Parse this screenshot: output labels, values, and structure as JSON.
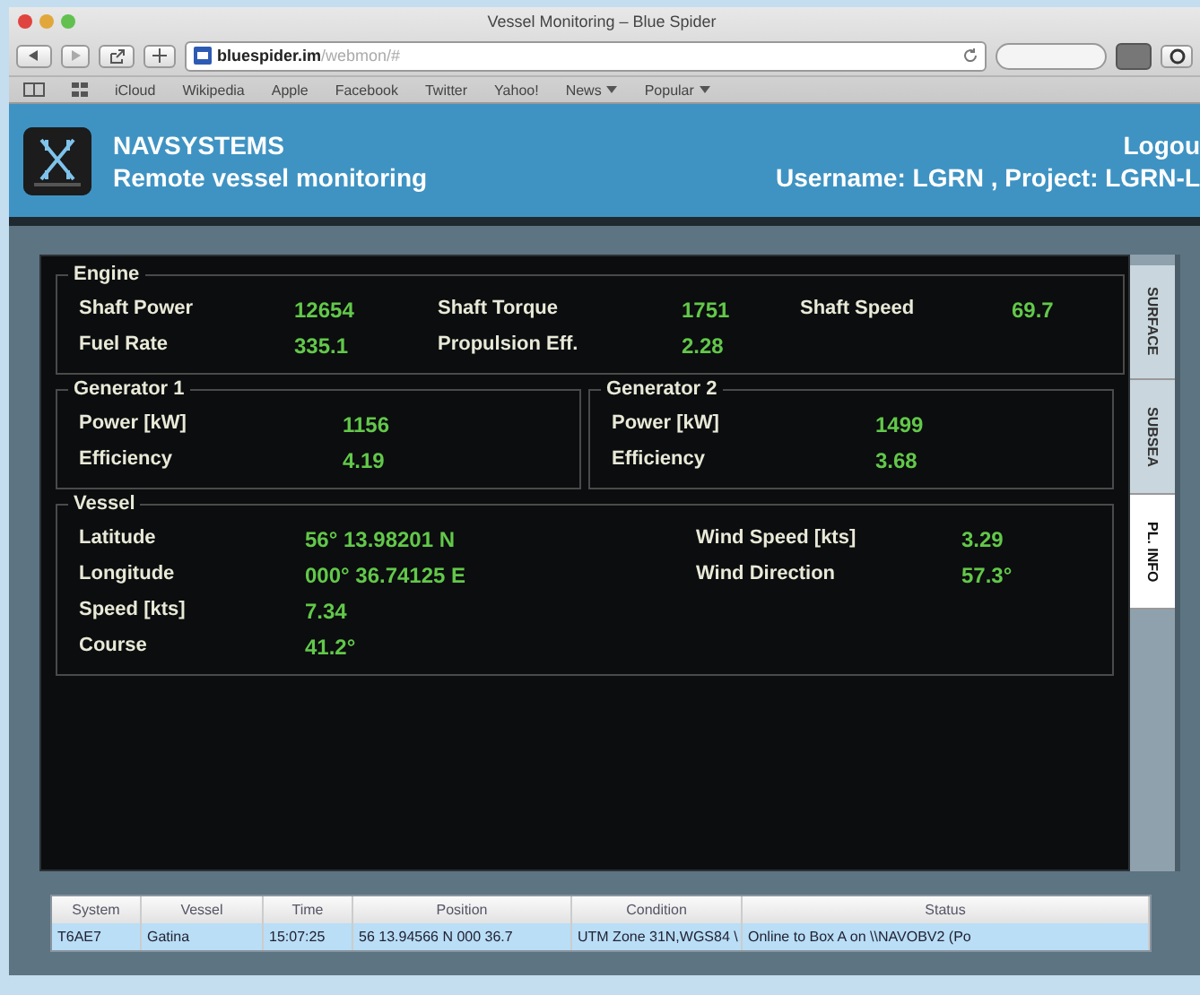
{
  "browser": {
    "title": "Vessel Monitoring – Blue Spider",
    "url_host": "bluespider.im",
    "url_path": "/webmon/#",
    "bookmarks": [
      {
        "label": "iCloud",
        "menu": false
      },
      {
        "label": "Wikipedia",
        "menu": false
      },
      {
        "label": "Apple",
        "menu": false
      },
      {
        "label": "Facebook",
        "menu": false
      },
      {
        "label": "Twitter",
        "menu": false
      },
      {
        "label": "Yahoo!",
        "menu": false
      },
      {
        "label": "News",
        "menu": true
      },
      {
        "label": "Popular",
        "menu": true
      }
    ]
  },
  "header": {
    "brand": "NAVSYSTEMS",
    "subtitle": "Remote vessel monitoring",
    "logout": "Logou",
    "user_line": "Username: LGRN , Project: LGRN-L"
  },
  "sections": [
    [
      {
        "title": "Engine",
        "rows": [
          [
            {
              "label": "Shaft Power",
              "value": "12654"
            },
            {
              "label": "Shaft Torque",
              "value": "1751"
            },
            {
              "label": "Shaft Speed",
              "value": "69.7"
            }
          ],
          [
            {
              "label": "Fuel Rate",
              "value": "335.1"
            },
            {
              "label": "Propulsion Eff.",
              "value": "2.28"
            }
          ]
        ]
      }
    ],
    [
      {
        "title": "Generator 1",
        "rows": [
          [
            {
              "label": "Power [kW]",
              "value": "1156"
            }
          ],
          [
            {
              "label": "Efficiency",
              "value": "4.19"
            }
          ]
        ]
      },
      {
        "title": "Generator 2",
        "rows": [
          [
            {
              "label": "Power [kW]",
              "value": "1499"
            }
          ],
          [
            {
              "label": "Efficiency",
              "value": "3.68"
            }
          ]
        ]
      }
    ],
    [
      {
        "title": "Vessel",
        "rows": [
          [
            {
              "label": "Latitude",
              "value": "56° 13.98201 N"
            },
            {
              "label": "Wind Speed [kts]",
              "value": "3.29"
            }
          ],
          [
            {
              "label": "Longitude",
              "value": "000° 36.74125 E"
            },
            {
              "label": "Wind Direction",
              "value": "57.3°"
            }
          ],
          [
            {
              "label": "Speed [kts]",
              "value": "7.34"
            }
          ],
          [
            {
              "label": "Course",
              "value": "41.2°"
            }
          ]
        ]
      }
    ]
  ],
  "side_tabs": [
    {
      "label": "SURFACE",
      "selected": false
    },
    {
      "label": "SUBSEA",
      "selected": false
    },
    {
      "label": "PL. INFO",
      "selected": true
    }
  ],
  "log": {
    "columns": [
      "System",
      "Vessel",
      "Time",
      "Position",
      "Condition",
      "Status"
    ],
    "rows": [
      {
        "selected": true,
        "cells": [
          "T6AE7",
          "Gatina",
          "15:07:25",
          "56  13.94566 N  000  36.7",
          "UTM Zone 31N,WGS84 \\",
          "Online to Box A on \\\\NAVOBV2 (Po"
        ]
      }
    ]
  }
}
